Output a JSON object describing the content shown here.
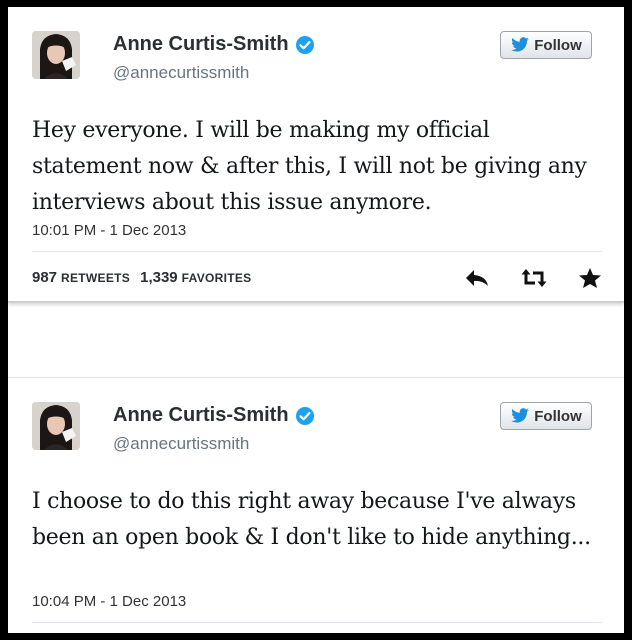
{
  "tweets": [
    {
      "user": {
        "name": "Anne Curtis-Smith",
        "handle": "@annecurtissmith"
      },
      "follow_label": "Follow",
      "text": "Hey everyone. I will be making my official statement now & after this, I will not be giving any interviews about this issue anymore.",
      "timestamp": "10:01 PM - 1 Dec 2013",
      "stats": {
        "retweets_count": "987",
        "retweets_label": "RETWEETS",
        "favorites_count": "1,339",
        "favorites_label": "FAVORITES"
      },
      "actions": [
        "reply-icon",
        "retweet-icon",
        "favorite-icon"
      ]
    },
    {
      "user": {
        "name": "Anne Curtis-Smith",
        "handle": "@annecurtissmith"
      },
      "follow_label": "Follow",
      "text": "I choose to do this right away because I've always been an open book & I don't like to hide anything...",
      "timestamp": "10:04 PM - 1 Dec 2013"
    }
  ],
  "colors": {
    "verified": "#1da1f2",
    "follow_bird": "#1d8fdc",
    "text": "#14171a",
    "muted": "#66757f"
  }
}
